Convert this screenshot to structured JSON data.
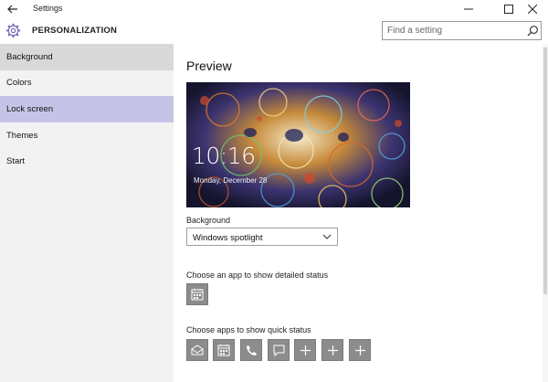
{
  "window": {
    "title": "Settings"
  },
  "header": {
    "section": "PERSONALIZATION",
    "search_placeholder": "Find a setting"
  },
  "sidebar": {
    "items": [
      {
        "label": "Background"
      },
      {
        "label": "Colors"
      },
      {
        "label": "Lock screen"
      },
      {
        "label": "Themes"
      },
      {
        "label": "Start"
      }
    ],
    "selected": "Lock screen",
    "hovered": "Background"
  },
  "main": {
    "preview_title": "Preview",
    "lock_time": "10:16",
    "lock_date": "Monday, December 28",
    "background_label": "Background",
    "background_value": "Windows spotlight",
    "detailed_label": "Choose an app to show detailed status",
    "detailed_icons": [
      "calendar-icon"
    ],
    "quick_label": "Choose apps to show quick status",
    "quick_icons": [
      "mail-icon",
      "calendar-icon",
      "phone-icon",
      "message-icon",
      "plus-icon",
      "plus-icon",
      "plus-icon"
    ]
  },
  "colors": {
    "selected_nav": "#c6c4e6",
    "hover_nav": "#d9d9d9",
    "tile": "#8c8c8c"
  }
}
